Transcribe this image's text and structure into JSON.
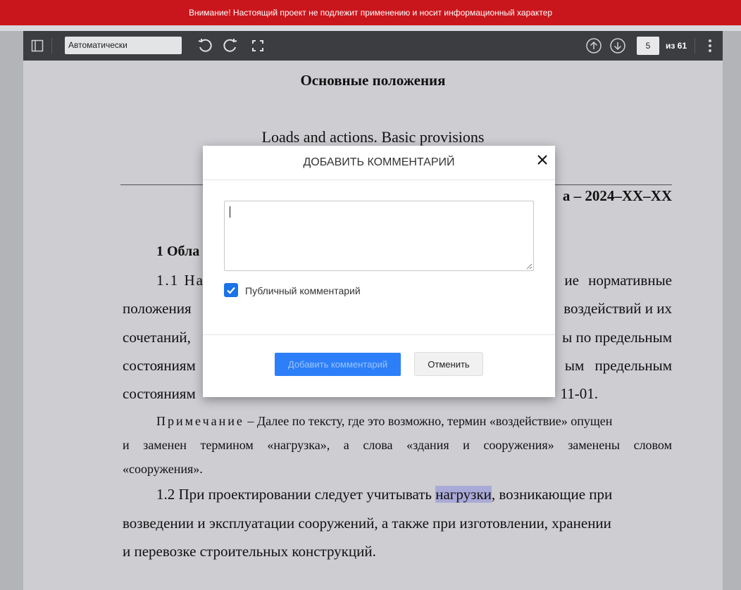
{
  "banner": {
    "text": "Внимание! Настоящий проект не подлежит применению и носит информационный характер",
    "color": "#c9161c"
  },
  "toolbar": {
    "sidebar_toggle_icon": "sidebar-icon",
    "scale_value": "Автоматически",
    "rotate_ccw_icon": "rotate-ccw-icon",
    "rotate_cw_icon": "rotate-cw-icon",
    "fullscreen_icon": "fullscreen-icon",
    "prev_page_icon": "arrow-up-circle-icon",
    "next_page_icon": "arrow-down-circle-icon",
    "page_number": "5",
    "page_total": "из 61",
    "more_icon": "kebab-menu-icon"
  },
  "document": {
    "title": "Основные положения",
    "subtitle_en": "Loads and actions. Basic provisions",
    "date_partial": "а – 2024–XX–XX",
    "section_heading": "1 Обла",
    "p1": {
      "l1_a": "1.1 На",
      "l1_b": "ие нормативные",
      "l2_a": "положения",
      "l2_b": "воздействий и их",
      "l3_a": "сочетаний,",
      "l3_b": "ы по предельным",
      "l4_a": "состояниям",
      "l4_b": "ым предельным",
      "l5_a": "состояниям",
      "l5_b": "11-01."
    },
    "note_label": "Примечание",
    "note_line1": " – Далее по тексту, где это возможно, термин «воздействие» опущен",
    "note_line2_words": [
      "и",
      "заменен",
      "термином",
      "«нагрузка»,",
      "а",
      "слова",
      "«здания",
      "и",
      "сооружения»",
      "заменены",
      "словом"
    ],
    "note_line3": "«сооружения».",
    "p2_l1_a": "1.2 При проектировании следует учитывать ",
    "p2_l1_hl": "нагрузки",
    "p2_l1_b": ", возникающие при",
    "p2_l2": "возведении и эксплуатации сооружений, а также при изготовлении, хранении",
    "p2_l3": "и перевозке строительных конструкций."
  },
  "dialog": {
    "title": "ДОБАВИТЬ КОММЕНТАРИЙ",
    "close_icon": "close-icon",
    "comment_value": "",
    "public_label": "Публичный комментарий",
    "public_checked": true,
    "submit_label": "Добавить комментарий",
    "cancel_label": "Отменить",
    "accent_color": "#2d7ff9"
  }
}
